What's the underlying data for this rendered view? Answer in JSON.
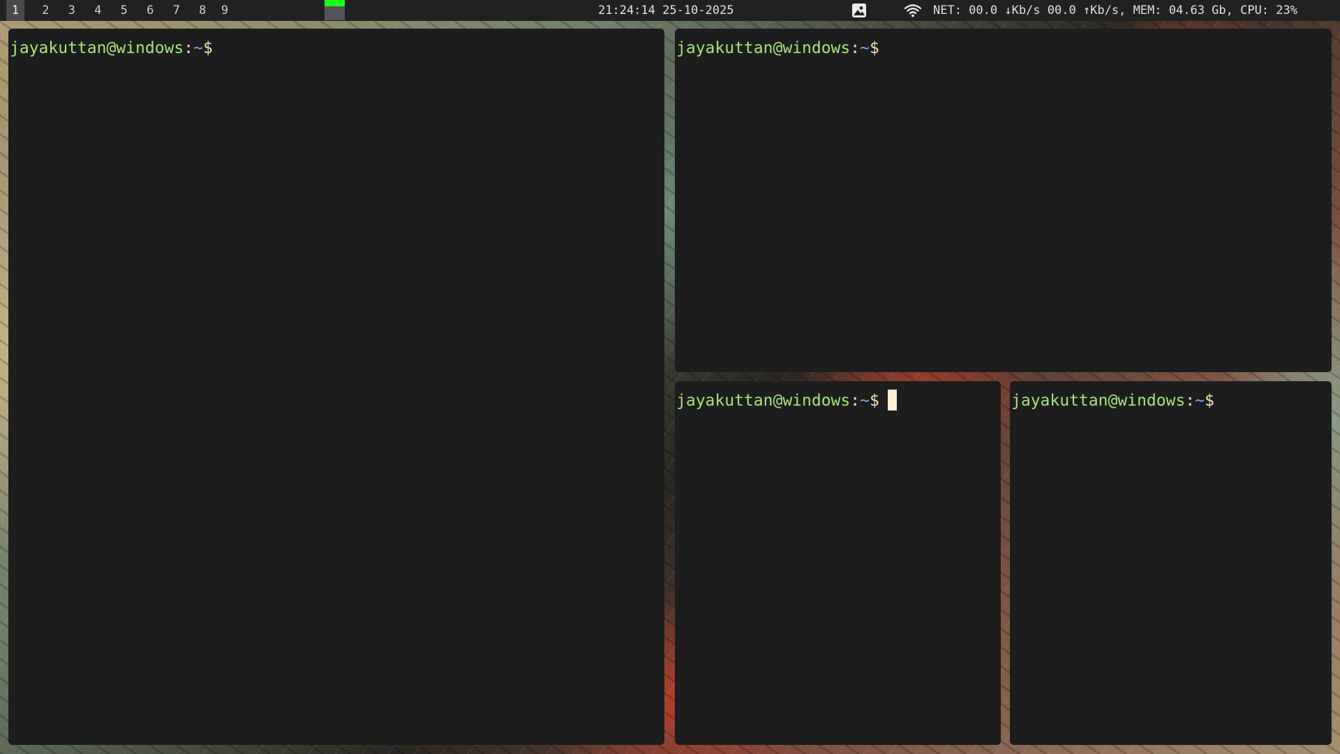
{
  "topbar": {
    "workspaces": [
      "1",
      "2",
      "3",
      "4",
      "5",
      "6",
      "7",
      "8",
      "9"
    ],
    "active_workspace": "1",
    "indicator_color": "#19ff19",
    "clock": "21:24:14 25-10-2025",
    "icons": [
      "image-icon",
      "wifi-icon"
    ],
    "status": "NET: 00.0 ↓Kb/s 00.0 ↑Kb/s, MEM: 04.63 Gb, CPU: 23%"
  },
  "terminals": [
    {
      "user_host": "jayakuttan@windows",
      "sep": ":",
      "path": "~",
      "prompt_char": "$",
      "focused": false
    },
    {
      "user_host": "jayakuttan@windows",
      "sep": ":",
      "path": "~",
      "prompt_char": "$",
      "focused": false
    },
    {
      "user_host": "jayakuttan@windows",
      "sep": ":",
      "path": "~",
      "prompt_char": "$",
      "focused": true
    },
    {
      "user_host": "jayakuttan@windows",
      "sep": ":",
      "path": "~",
      "prompt_char": "$",
      "focused": false
    }
  ],
  "colors": {
    "bar_bg": "#212121",
    "terminal_bg": "#1d1d1d",
    "user_host": "#a5e37d",
    "path": "#6fb0ff",
    "prompt": "#efe3b8",
    "cursor": "#f7efcf"
  }
}
